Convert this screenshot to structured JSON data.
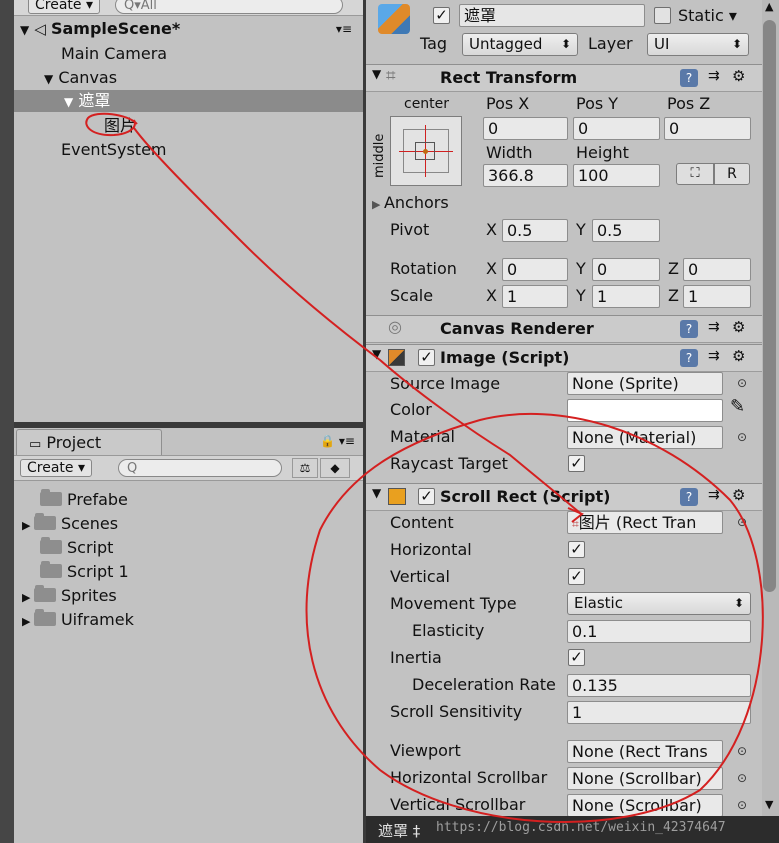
{
  "hierarchy": {
    "create_label": "Create ▾",
    "search_placeholder": "Q▾All",
    "scene_name": "SampleScene*",
    "menu_glyph": "▾≡",
    "items": [
      "Main Camera",
      "Canvas",
      "遮罩",
      "图片",
      "EventSystem"
    ]
  },
  "project": {
    "tab_label": "Project",
    "lock_glyph": "🔒 ▾≡",
    "create_label": "Create ▾",
    "search_placeholder": "Q",
    "folders": [
      "Prefabe",
      "Scenes",
      "Script",
      "Script 1",
      "Sprites",
      "Uiframek"
    ]
  },
  "inspector": {
    "object_name": "遮罩",
    "static_label": "Static ▾",
    "tag_label": "Tag",
    "tag_value": "Untagged",
    "layer_label": "Layer",
    "layer_value": "UI",
    "rect_transform": {
      "title": "Rect Transform",
      "anchor_h": "center",
      "anchor_v": "middle",
      "pos_x_label": "Pos X",
      "pos_y_label": "Pos Y",
      "pos_z_label": "Pos Z",
      "pos_x": "0",
      "pos_y": "0",
      "pos_z": "0",
      "width_label": "Width",
      "height_label": "Height",
      "width": "366.8",
      "height": "100",
      "r_button": "R",
      "anchors_label": "Anchors",
      "pivot_label": "Pivot",
      "pivot_x": "0.5",
      "pivot_y": "0.5",
      "rotation_label": "Rotation",
      "rot_x": "0",
      "rot_y": "0",
      "rot_z": "0",
      "scale_label": "Scale",
      "scale_x": "1",
      "scale_y": "1",
      "scale_z": "1",
      "x": "X",
      "y": "Y",
      "z": "Z"
    },
    "canvas_renderer": {
      "title": "Canvas Renderer"
    },
    "image": {
      "title": "Image (Script)",
      "source_image_label": "Source Image",
      "source_image": "None (Sprite)",
      "color_label": "Color",
      "material_label": "Material",
      "material": "None (Material)",
      "raycast_label": "Raycast Target"
    },
    "scroll_rect": {
      "title": "Scroll Rect (Script)",
      "content_label": "Content",
      "content": "图片 (Rect Tran",
      "horizontal_label": "Horizontal",
      "vertical_label": "Vertical",
      "movement_label": "Movement Type",
      "movement": "Elastic",
      "elasticity_label": "Elasticity",
      "elasticity": "0.1",
      "inertia_label": "Inertia",
      "decel_label": "Deceleration Rate",
      "decel": "0.135",
      "sensitivity_label": "Scroll Sensitivity",
      "sensitivity": "1",
      "viewport_label": "Viewport",
      "viewport": "None (Rect Trans",
      "hscroll_label": "Horizontal Scrollbar",
      "hscroll": "None (Scrollbar)",
      "vscroll_label": "Vertical Scrollbar",
      "vscroll": "None (Scrollbar)"
    },
    "footer_label": "遮罩 ‡",
    "watermark": "https://blog.csdn.net/weixin_42374647"
  },
  "colors": {
    "annotation": "#d42020",
    "panel": "#c2c2c2",
    "selection": "#8b8b8b"
  }
}
